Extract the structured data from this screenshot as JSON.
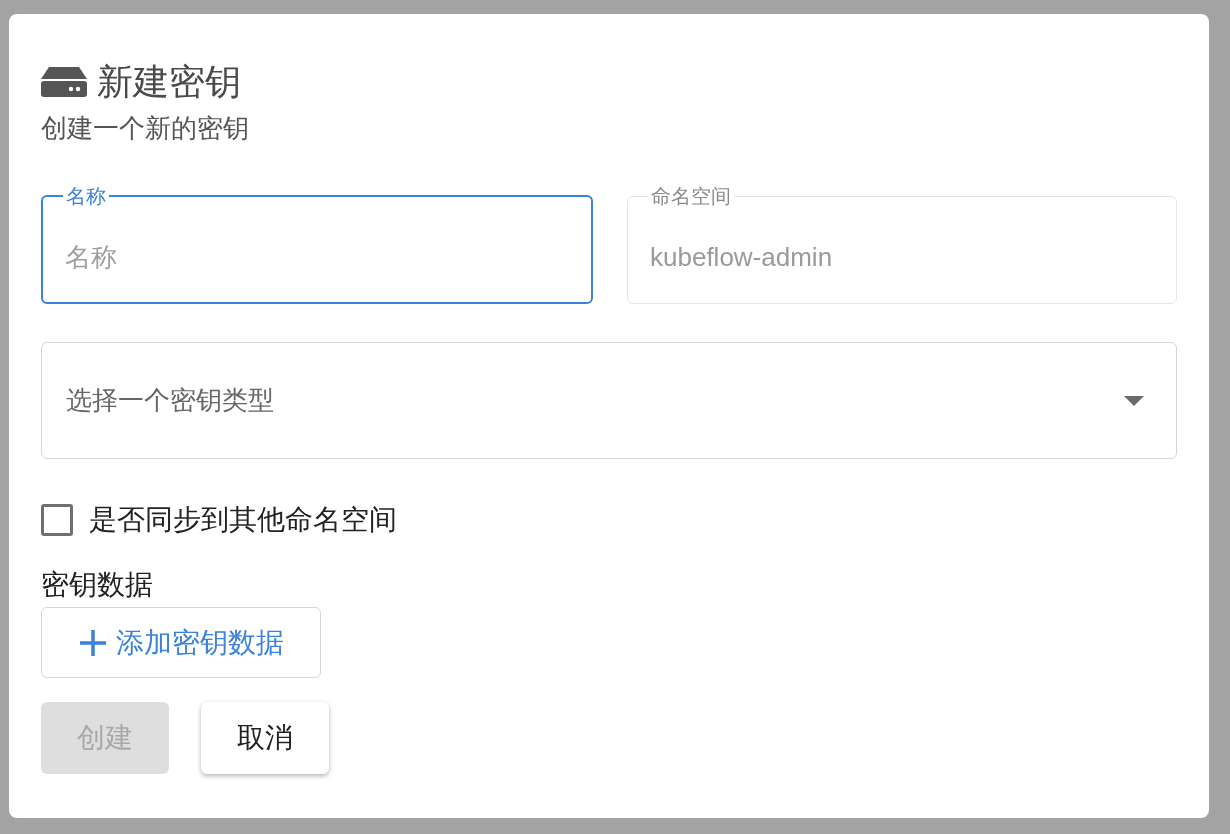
{
  "dialog": {
    "title": "新建密钥",
    "subtitle": "创建一个新的密钥",
    "fields": [
      {
        "label": "名称",
        "placeholder": "名称",
        "focused": true,
        "disabled": false
      },
      {
        "label": "命名空间",
        "value": "kubeflow-admin",
        "focused": false,
        "disabled": true
      }
    ],
    "select": {
      "placeholder": "选择一个密钥类型"
    },
    "sync_checkbox": {
      "label": "是否同步到其他命名空间",
      "checked": false
    },
    "data_section": {
      "title": "密钥数据",
      "add_button": "添加密钥数据"
    },
    "buttons": [
      {
        "label": "创建",
        "disabled": true
      },
      {
        "label": "取消",
        "disabled": false
      }
    ]
  }
}
